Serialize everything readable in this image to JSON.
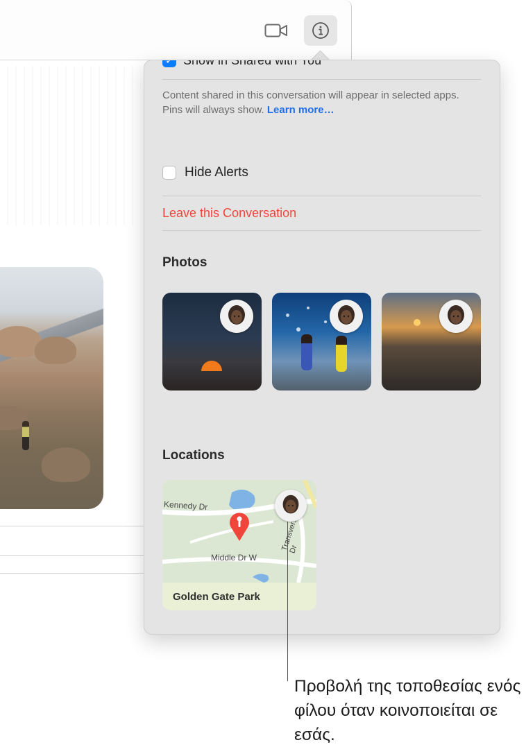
{
  "toolbar": {
    "video_icon": "video-camera-icon",
    "info_icon": "info-circle-icon"
  },
  "panel": {
    "shared_with_you_label": "Show in Shared with You",
    "description": "Content shared in this conversation will appear in selected apps. Pins will always show.",
    "learn_more_link": "Learn more…",
    "hide_alerts_label": "Hide Alerts",
    "hide_alerts_checked": false,
    "shared_with_you_checked": true,
    "leave_label": "Leave this Conversation",
    "photos_title": "Photos",
    "locations_title": "Locations",
    "map": {
      "street_1": "Kennedy Dr",
      "street_2": "Middle Dr W",
      "street_3": "Transverse Dr",
      "caption": "Golden Gate Park"
    }
  },
  "callout": {
    "text": "Προβολή της τοποθεσίας ενός φίλου όταν κοινοποιείται σε εσάς."
  },
  "colors": {
    "accent_blue": "#0a7cff",
    "destructive_red": "#f0453a",
    "panel_bg": "#e4e4e4"
  }
}
